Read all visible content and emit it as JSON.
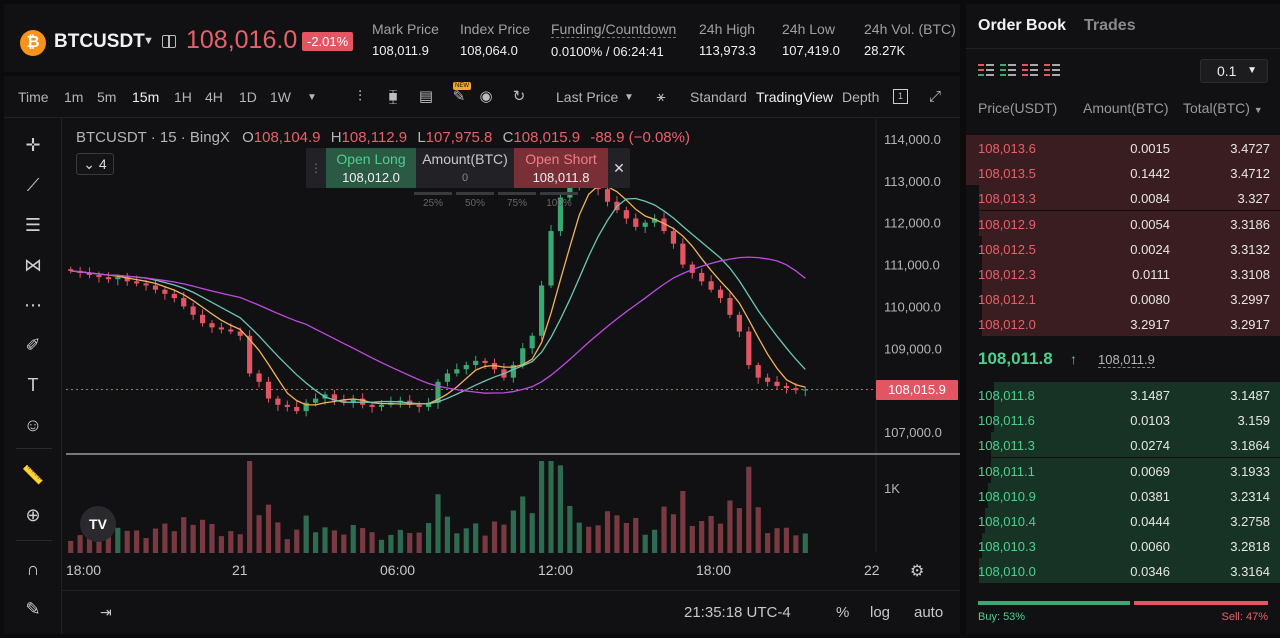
{
  "header": {
    "symbol": "BTCUSDT",
    "coin_glyph": "₿",
    "last_price": "108,016.0",
    "change": "-2.01%",
    "stats": [
      {
        "label": "Mark Price",
        "value": "108,011.9"
      },
      {
        "label": "Index Price",
        "value": "108,064.0"
      },
      {
        "label": "Funding/Countdown",
        "value": "0.0100% / 06:24:41"
      },
      {
        "label": "24h High",
        "value": "113,973.3"
      },
      {
        "label": "24h Low",
        "value": "107,419.0"
      },
      {
        "label": "24h Vol. (BTC)",
        "value": "28.27K"
      }
    ]
  },
  "toolbar": {
    "intervals": [
      "Time",
      "1m",
      "5m",
      "15m",
      "1H",
      "4H",
      "1D",
      "1W"
    ],
    "active_interval": "15m",
    "new_badge": "NEW",
    "price_type": "Last Price",
    "views": [
      "Standard",
      "TradingView",
      "Depth"
    ],
    "active_view": "TradingView"
  },
  "legend": {
    "title": "BTCUSDT · 15 · BingX",
    "o_key": "O",
    "o": "108,104.9",
    "h_key": "H",
    "h": "108,112.9",
    "l_key": "L",
    "l": "107,975.8",
    "c_key": "C",
    "c": "108,015.9",
    "chg": "-88.9 (−0.08%)",
    "indicator_count": "4"
  },
  "trade_widget": {
    "long_label": "Open Long",
    "long_price": "108,012.0",
    "amount_label": "Amount(BTC)",
    "amount_value": "0",
    "short_label": "Open Short",
    "short_price": "108,011.8",
    "percents": [
      "25%",
      "50%",
      "75%",
      "100%"
    ]
  },
  "price_axis": [
    "114,000.0",
    "113,000.0",
    "112,000.0",
    "111,000.0",
    "110,000.0",
    "109,000.0",
    "107,000.0"
  ],
  "current_price_tag": "108,015.9",
  "volume_axis": "1K",
  "time_axis": [
    "18:00",
    "21",
    "06:00",
    "12:00",
    "18:00",
    "22"
  ],
  "bottom_bar": {
    "clock": "21:35:18 UTC-4",
    "pct": "%",
    "log": "log",
    "auto": "auto"
  },
  "chart_data": {
    "type": "candlestick",
    "interval": "15m",
    "price_range": [
      106500,
      114500
    ],
    "closes": [
      110850,
      110800,
      110750,
      110700,
      110650,
      110700,
      110600,
      110550,
      110500,
      110400,
      110300,
      110200,
      110000,
      109800,
      109600,
      109500,
      109450,
      109400,
      109300,
      108400,
      108200,
      107800,
      107650,
      107600,
      107500,
      107700,
      107800,
      107900,
      107750,
      107700,
      107800,
      107650,
      107600,
      107650,
      107700,
      107750,
      107650,
      107600,
      107700,
      108200,
      108400,
      108500,
      108600,
      108700,
      108650,
      108500,
      108300,
      108600,
      109000,
      109300,
      110500,
      111800,
      112600,
      112900,
      113100,
      113000,
      112800,
      112500,
      112300,
      112100,
      111900,
      112000,
      112100,
      111800,
      111500,
      111000,
      110800,
      110600,
      110400,
      110200,
      109800,
      109400,
      108600,
      108300,
      108200,
      108100,
      108050,
      108000,
      108016
    ],
    "volume_max": 1000
  },
  "orderbook": {
    "tabs": [
      "Order Book",
      "Trades"
    ],
    "step": "0.1",
    "columns": [
      "Price(USDT)",
      "Amount(BTC)",
      "Total(BTC)"
    ],
    "asks": [
      {
        "price": "108,013.6",
        "amount": "0.0015",
        "total": "3.4727",
        "depth": 1.0
      },
      {
        "price": "108,013.5",
        "amount": "0.1442",
        "total": "3.4712",
        "depth": 1.0
      },
      {
        "price": "108,013.3",
        "amount": "0.0084",
        "total": "3.327",
        "depth": 0.96
      },
      {
        "price": "108,012.9",
        "amount": "0.0054",
        "total": "3.3186",
        "depth": 0.96
      },
      {
        "price": "108,012.5",
        "amount": "0.0024",
        "total": "3.3132",
        "depth": 0.95
      },
      {
        "price": "108,012.3",
        "amount": "0.0111",
        "total": "3.3108",
        "depth": 0.95
      },
      {
        "price": "108,012.1",
        "amount": "0.0080",
        "total": "3.2997",
        "depth": 0.95
      },
      {
        "price": "108,012.0",
        "amount": "3.2917",
        "total": "3.2917",
        "depth": 0.95
      }
    ],
    "mid_price": "108,011.8",
    "mid_arrow": "↑",
    "mark_price": "108,011.9",
    "bids": [
      {
        "price": "108,011.8",
        "amount": "3.1487",
        "total": "3.1487",
        "depth": 0.91
      },
      {
        "price": "108,011.6",
        "amount": "0.0103",
        "total": "3.159",
        "depth": 0.91
      },
      {
        "price": "108,011.3",
        "amount": "0.0274",
        "total": "3.1864",
        "depth": 0.92
      },
      {
        "price": "108,011.1",
        "amount": "0.0069",
        "total": "3.1933",
        "depth": 0.92
      },
      {
        "price": "108,010.9",
        "amount": "0.0381",
        "total": "3.2314",
        "depth": 0.93
      },
      {
        "price": "108,010.4",
        "amount": "0.0444",
        "total": "3.2758",
        "depth": 0.94
      },
      {
        "price": "108,010.3",
        "amount": "0.0060",
        "total": "3.2818",
        "depth": 0.95
      },
      {
        "price": "108,010.0",
        "amount": "0.0346",
        "total": "3.3164",
        "depth": 0.96
      }
    ],
    "buy_label": "Buy: 53%",
    "sell_label": "Sell: 47%",
    "buy_ratio": 0.53
  },
  "colors": {
    "up": "#3aa873",
    "down": "#e25563",
    "ma_fast": "#f0b35a",
    "ma_mid": "#6cc7b5",
    "ma_slow": "#c04ae0"
  }
}
